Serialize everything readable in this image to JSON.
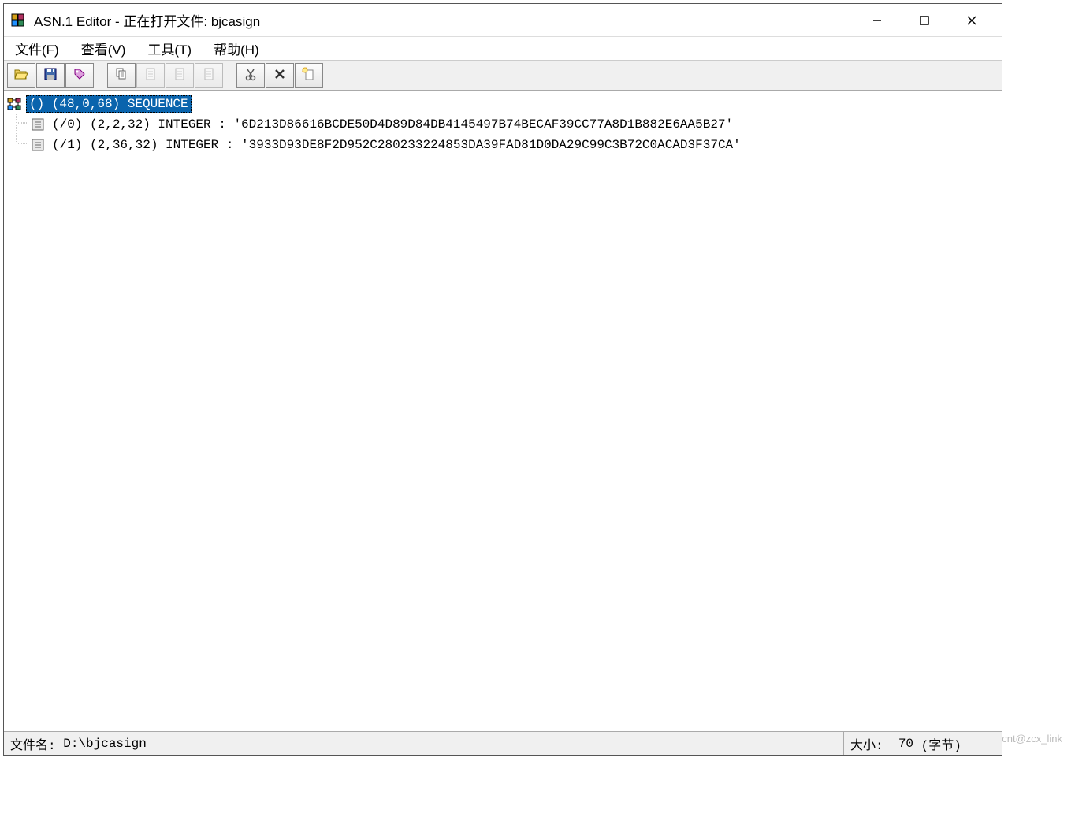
{
  "window": {
    "title": "ASN.1 Editor - 正在打开文件: bjcasign"
  },
  "menu": {
    "file": "文件(F)",
    "view": "查看(V)",
    "tools": "工具(T)",
    "help": "帮助(H)"
  },
  "toolbar_icons": {
    "open": "open-icon",
    "save": "save-icon",
    "tag": "tag-icon",
    "copy": "copy-icon",
    "doc1": "document-icon",
    "doc2": "document-icon",
    "doc3": "document-icon",
    "cut": "cut-icon",
    "delete": "delete-icon",
    "new": "new-icon"
  },
  "tree": {
    "root": {
      "label": "() (48,0,68) SEQUENCE"
    },
    "children": [
      {
        "label": "(/0) (2,2,32) INTEGER : '6D213D86616BCDE50D4D89D84DB4145497B74BECAF39CC77A8D1B882E6AA5B27'"
      },
      {
        "label": "(/1) (2,36,32) INTEGER : '3933D93DE8F2D952C280233224853DA39FAD81D0DA29C99C3B72C0ACAD3F37CA'"
      }
    ]
  },
  "statusbar": {
    "filename_label": "文件名:",
    "filename_value": "D:\\bjcasign",
    "size_label": "大小:",
    "size_value": "70",
    "size_unit": "(字节)"
  },
  "watermark": "cnt@zcx_link"
}
